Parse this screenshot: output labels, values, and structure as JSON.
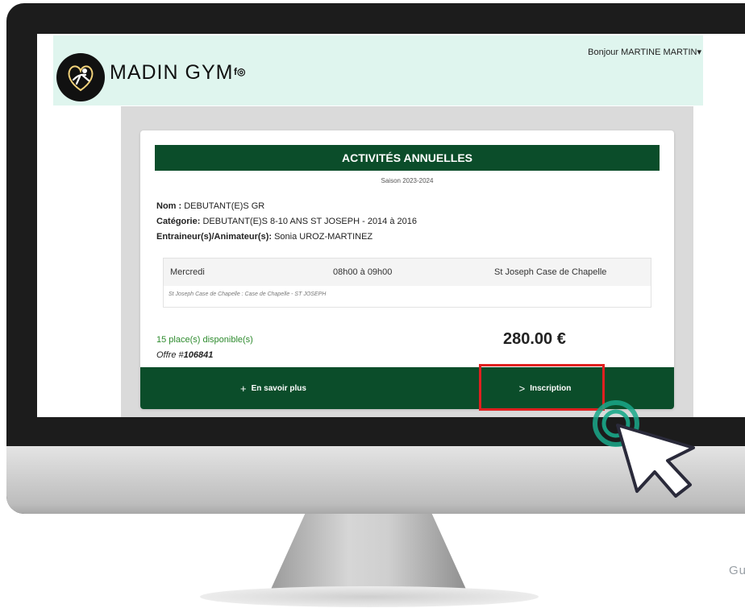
{
  "header": {
    "title": "MADIN GYM",
    "social": "f◎",
    "greeting": "Bonjour MARTINE MARTIN▾"
  },
  "card": {
    "title": "ACTIVITÉS ANNUELLES",
    "season": "Saison 2023-2024",
    "nom_label": "Nom :",
    "nom_value": " DEBUTANT(E)S GR",
    "categorie_label": "Catégorie:",
    "categorie_value": " DEBUTANT(E)S 8-10 ANS ST JOSEPH - 2014 à 2016",
    "entraineur_label": "Entraineur(s)/Animateur(s):",
    "entraineur_value": " Sonia UROZ-MARTINEZ",
    "schedule": {
      "day": "Mercredi",
      "time": "08h00 à 09h00",
      "place": "St Joseph Case de Chapelle",
      "location_detail": "St Joseph Case de Chapelle : Case de Chapelle - ST JOSEPH"
    },
    "places": "15 place(s) disponible(s)",
    "offer_prefix": "Offre #",
    "offer_number": "106841",
    "price": "280.00 €",
    "more_button": "En savoir plus",
    "more_icon_glyph": "+",
    "register_button": "Inscription",
    "register_icon_glyph": ">"
  },
  "watermark": "Gu",
  "colors": {
    "header_bg": "#dff5ee",
    "brand_green": "#0b4d2a",
    "available_green": "#2e8b2e",
    "highlight_red": "#e02020",
    "ripple_teal": "#1aa88a"
  },
  "icons": [
    "gymnast-logo-icon",
    "facebook-icon",
    "instagram-icon",
    "plus-icon",
    "chevron-right-icon",
    "cursor-arrow-icon"
  ]
}
